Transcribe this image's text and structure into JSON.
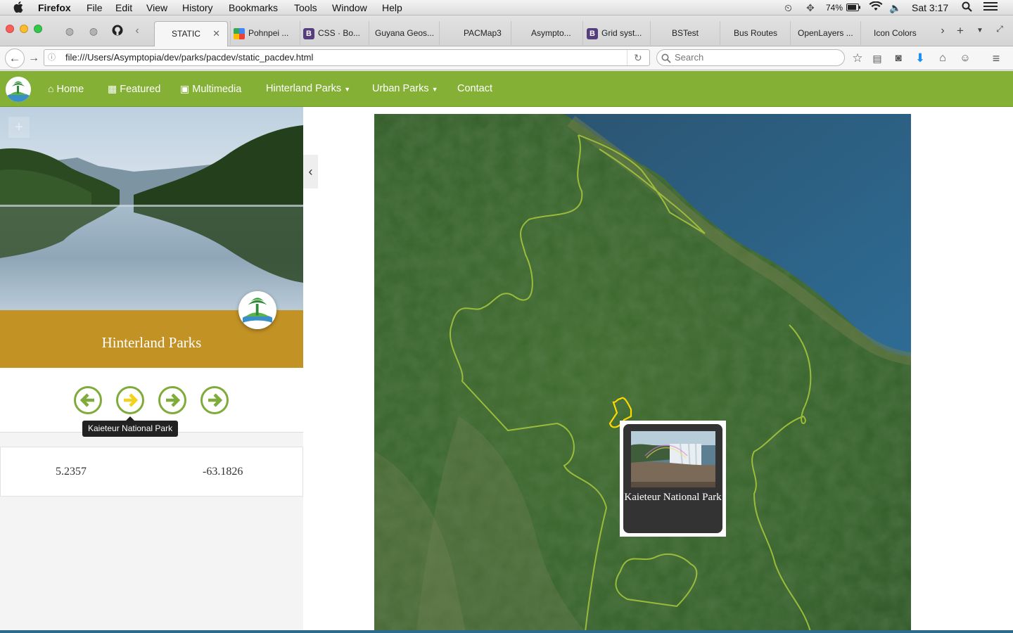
{
  "menubar": {
    "app_name": "Firefox",
    "menus": [
      "File",
      "Edit",
      "View",
      "History",
      "Bookmarks",
      "Tools",
      "Window",
      "Help"
    ],
    "battery": "74%",
    "clock": "Sat 3:17"
  },
  "tabs": [
    {
      "label": "STATIC",
      "active": true
    },
    {
      "label": "Pohnpei ...",
      "favicon_color": "#4285f4"
    },
    {
      "label": "CSS · Bo...",
      "favicon_color": "#563d7c",
      "favicon_text": "B"
    },
    {
      "label": "Guyana Geos...",
      "favicon_color": ""
    },
    {
      "label": "PACMap3",
      "favicon_color": ""
    },
    {
      "label": "Asympto...",
      "favicon_color": ""
    },
    {
      "label": "Grid syst...",
      "favicon_color": "#563d7c",
      "favicon_text": "B"
    },
    {
      "label": "BSTest",
      "favicon_color": ""
    },
    {
      "label": "Bus Routes",
      "favicon_color": ""
    },
    {
      "label": "OpenLayers ...",
      "favicon_color": ""
    },
    {
      "label": "Icon Colors",
      "favicon_color": ""
    }
  ],
  "browser": {
    "url": "file:///Users/Asymptopia/dev/parks/pacdev/static_pacdev.html",
    "search_placeholder": "Search"
  },
  "site_nav": {
    "home": "Home",
    "featured": "Featured",
    "multimedia": "Multimedia",
    "hinterland": "Hinterland Parks",
    "urban": "Urban Parks",
    "contact": "Contact"
  },
  "panel": {
    "title": "Hinterland Parks",
    "tooltip": "Kaieteur National Park",
    "latitude": "5.2357",
    "longitude": "-63.1826",
    "arrow_highlight_color": "#f3d21b",
    "arrow_color": "#7fab3a"
  },
  "map": {
    "popup_title": "Kaieteur National Park",
    "boundary_color": "#a4c43c",
    "highlight_color": "#ffd800"
  }
}
